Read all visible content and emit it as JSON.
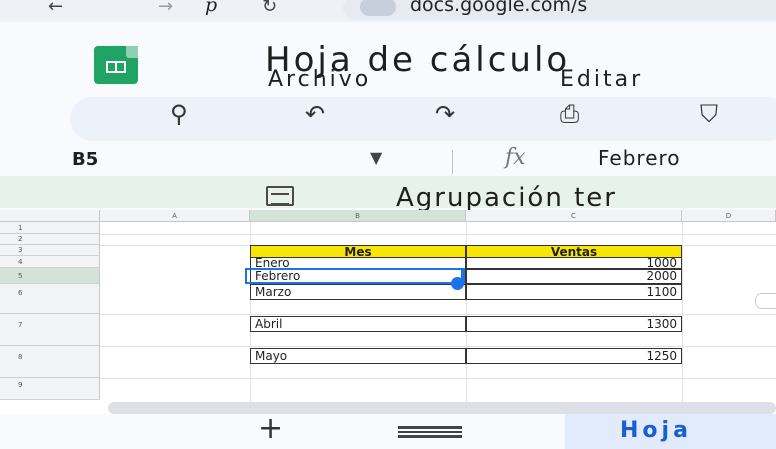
{
  "browser": {
    "cut_text": "p",
    "url": "docs.google.com/s"
  },
  "doc": {
    "title": "Hoja de cálculo",
    "menu": [
      "Archivo",
      "Editar"
    ]
  },
  "formula_bar": {
    "cell_ref": "B5",
    "fx": "fx",
    "value": "Febrero"
  },
  "group": {
    "label": "Agrupación ter"
  },
  "grid": {
    "columns": [
      "A",
      "B",
      "C",
      "D"
    ],
    "rows": [
      "1",
      "2",
      "3",
      "4",
      "5",
      "6",
      "7",
      "8",
      "9"
    ],
    "headers": [
      "Mes",
      "Ventas"
    ],
    "data": [
      {
        "mes": "Enero",
        "ventas": "1000"
      },
      {
        "mes": "Febrero",
        "ventas": "2000"
      },
      {
        "mes": "Marzo",
        "ventas": "1100"
      },
      {
        "mes": "Abril",
        "ventas": "1300"
      },
      {
        "mes": "Mayo",
        "ventas": "1250"
      }
    ]
  },
  "bottom": {
    "sheet_tab": "Hoja"
  },
  "colors": {
    "accent": "#1a73e8",
    "header_fill": "#f7e600",
    "sheets_green": "#1fa463"
  },
  "icons": [
    "back-arrow-icon",
    "forward-arrow-icon",
    "reload-icon",
    "site-settings-icon",
    "search-icon",
    "undo-icon",
    "redo-icon",
    "print-icon",
    "paint-format-icon",
    "group-icon",
    "plus-icon",
    "menu-icon"
  ]
}
